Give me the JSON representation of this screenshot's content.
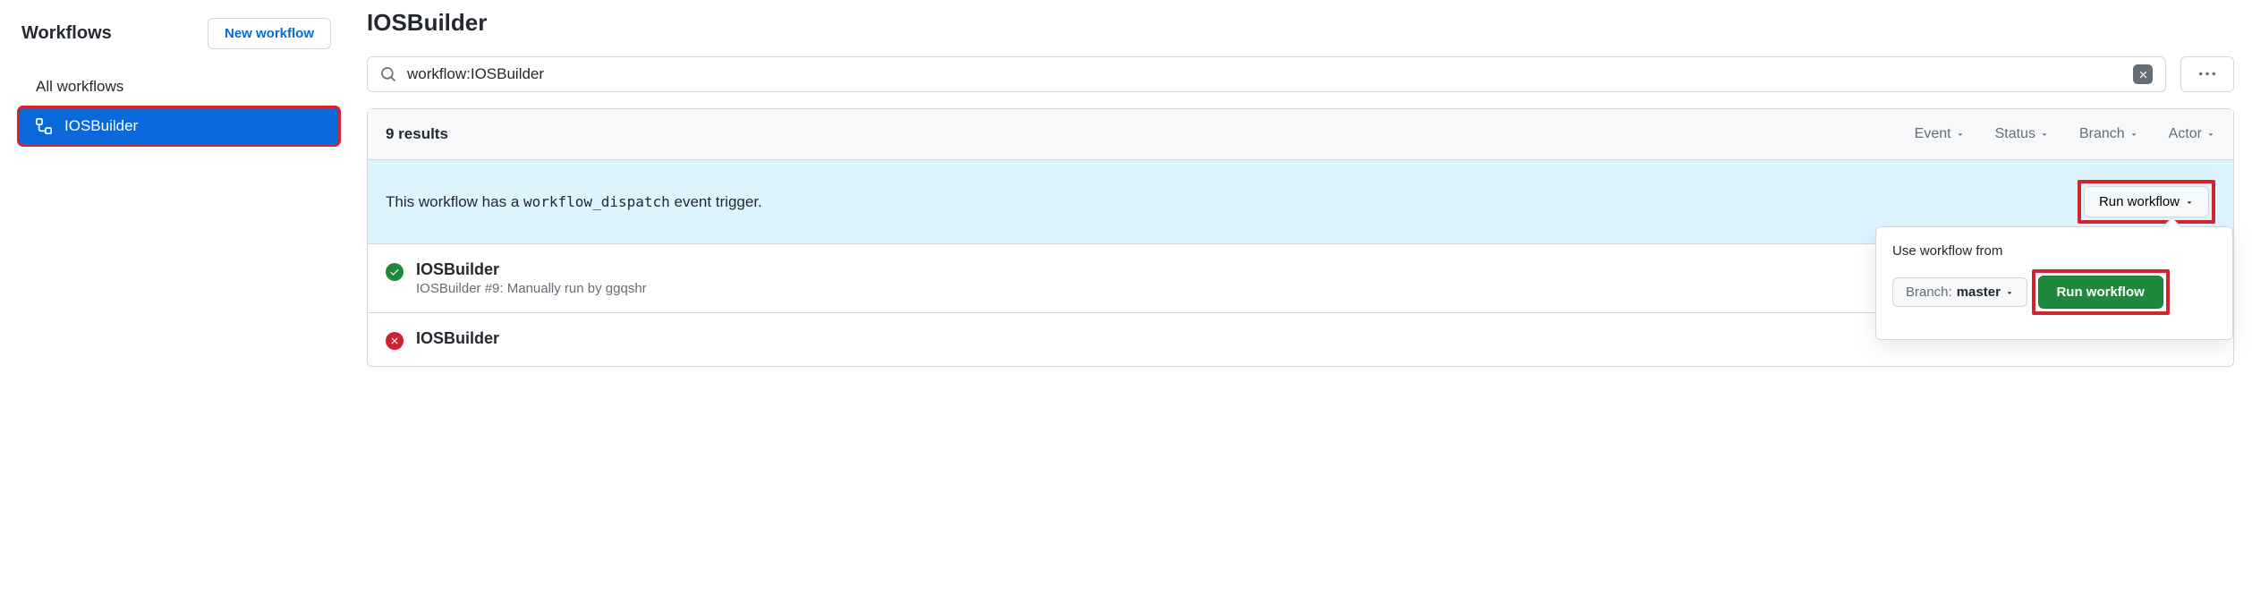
{
  "sidebar": {
    "title": "Workflows",
    "new_workflow_label": "New workflow",
    "items": [
      {
        "label": "All workflows",
        "active": false
      },
      {
        "label": "IOSBuilder",
        "active": true
      }
    ]
  },
  "main": {
    "title": "IOSBuilder",
    "search": {
      "value": "workflow:IOSBuilder"
    },
    "results_count": "9 results",
    "filters": {
      "event": "Event",
      "status": "Status",
      "branch": "Branch",
      "actor": "Actor"
    },
    "dispatch": {
      "prefix": "This workflow has a ",
      "code": "workflow_dispatch",
      "suffix": " event trigger.",
      "run_button": "Run workflow"
    },
    "popover": {
      "label": "Use workflow from",
      "branch_label": "Branch:",
      "branch_value": "master",
      "submit": "Run workflow"
    },
    "runs": [
      {
        "status": "success",
        "title": "IOSBuilder",
        "workflow_name": "IOSBuilder",
        "meta": " #9: Manually run by ggqshr"
      },
      {
        "status": "failure",
        "title": "IOSBuilder"
      }
    ]
  }
}
